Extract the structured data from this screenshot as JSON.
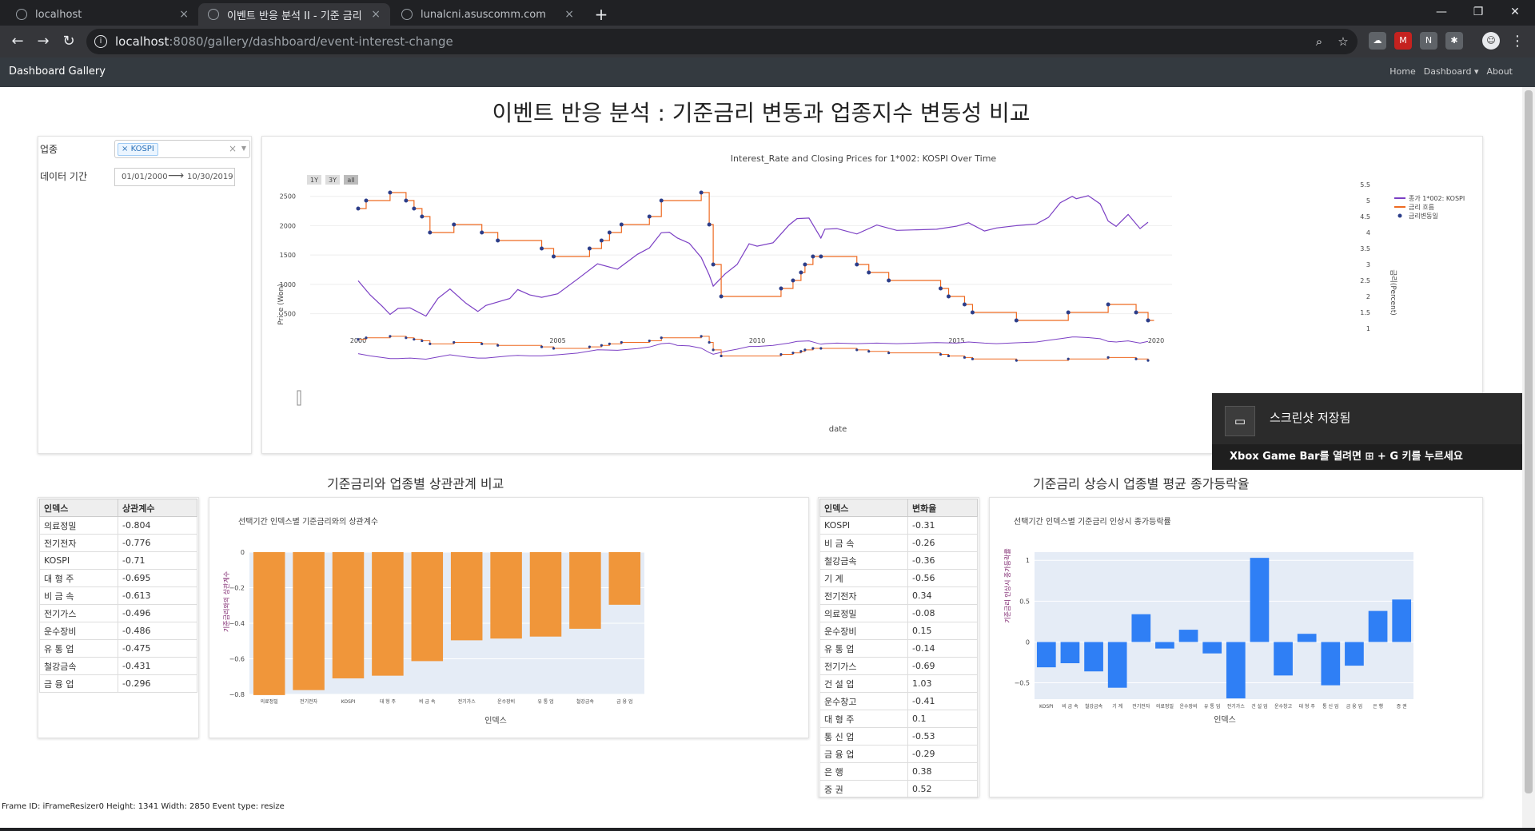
{
  "browser": {
    "tabs": [
      {
        "title": "localhost",
        "active": false
      },
      {
        "title": "이벤트 반응 분석 II - 기준 금리",
        "active": true
      },
      {
        "title": "lunalcni.asuscomm.com",
        "active": false
      }
    ],
    "address": {
      "host": "localhost",
      "path": ":8080/gallery/dashboard/event-interest-change"
    }
  },
  "app": {
    "brand": "Dashboard Gallery",
    "nav": {
      "home": "Home",
      "dashboard": "Dashboard",
      "about": "About"
    }
  },
  "page": {
    "title": "이벤트 반응 분석 : 기준금리 변동과 업종지수 변동성 비교"
  },
  "filters": {
    "industry_label": "업종",
    "industry_selected": "KOSPI",
    "period_label": "데이터 기간",
    "start_date": "01/01/2000",
    "end_date": "10/30/2019"
  },
  "timeseries": {
    "title": "Interest_Rate and Closing Prices for 1*002: KOSPI Over Time",
    "range_buttons": [
      "1Y",
      "3Y",
      "all"
    ],
    "ylabel_left": "Price (Won)",
    "ylabel_right": "금리(Percent)",
    "xlabel": "date",
    "legend": [
      "종가 1*002: KOSPI",
      "금리 흐름",
      "금리변동일"
    ],
    "colors": {
      "price": "#7b3fc4",
      "rate": "#ee6a22",
      "event": "#2c3e8a"
    }
  },
  "correlation": {
    "section_title": "기준금리와 업종별 상관관계 비교",
    "headers": [
      "인덱스",
      "상관계수"
    ],
    "rows": [
      [
        "의료정밀",
        "-0.804"
      ],
      [
        "전기전자",
        "-0.776"
      ],
      [
        "KOSPI",
        "-0.71"
      ],
      [
        "대 형 주",
        "-0.695"
      ],
      [
        "비 금 속",
        "-0.613"
      ],
      [
        "전기가스",
        "-0.496"
      ],
      [
        "운수장비",
        "-0.486"
      ],
      [
        "유 통 업",
        "-0.475"
      ],
      [
        "철강금속",
        "-0.431"
      ],
      [
        "금 융 업",
        "-0.296"
      ]
    ]
  },
  "change": {
    "section_title": "기준금리 상승시 업종별 평균 종가등락율",
    "headers": [
      "인덱스",
      "변화율"
    ],
    "rows": [
      [
        "KOSPI",
        "-0.31"
      ],
      [
        "비 금 속",
        "-0.26"
      ],
      [
        "철강금속",
        "-0.36"
      ],
      [
        "기 계",
        "-0.56"
      ],
      [
        "전기전자",
        "0.34"
      ],
      [
        "의료정밀",
        "-0.08"
      ],
      [
        "운수장비",
        "0.15"
      ],
      [
        "유 통 업",
        "-0.14"
      ],
      [
        "전기가스",
        "-0.69"
      ],
      [
        "건 설 업",
        "1.03"
      ],
      [
        "운수창고",
        "-0.41"
      ],
      [
        "대 형 주",
        "0.1"
      ],
      [
        "통 신 업",
        "-0.53"
      ],
      [
        "금 융 업",
        "-0.29"
      ],
      [
        "은 행",
        "0.38"
      ],
      [
        "증 권",
        "0.52"
      ]
    ]
  },
  "chart_data": [
    {
      "type": "line",
      "title": "Interest_Rate and Closing Prices for 1*002: KOSPI Over Time",
      "xlabel": "date",
      "ylabel": "Price (Won)",
      "ylabel_right": "금리(Percent)",
      "xlim": [
        2000,
        2020
      ],
      "ylim": [
        250,
        2700
      ],
      "ylim_right": [
        1,
        5.5
      ],
      "x_ticks": [
        "2000",
        "2005",
        "2010",
        "2015",
        "2020"
      ],
      "y_ticks": [
        "500",
        "1000",
        "1500",
        "2000",
        "2500"
      ],
      "y_right_ticks": [
        "1",
        "1.5",
        "2",
        "2.5",
        "3",
        "3.5",
        "4",
        "4.5",
        "5",
        "5.5"
      ],
      "series": [
        {
          "name": "종가 1*002: KOSPI",
          "x": [
            2000.0,
            2000.3,
            2000.6,
            2000.8,
            2001.0,
            2001.3,
            2001.7,
            2002.0,
            2002.3,
            2002.7,
            2003.0,
            2003.2,
            2003.5,
            2003.8,
            2004.0,
            2004.3,
            2004.6,
            2005.0,
            2005.5,
            2006.0,
            2006.5,
            2007.0,
            2007.3,
            2007.6,
            2007.8,
            2008.0,
            2008.3,
            2008.6,
            2008.8,
            2008.9,
            2009.2,
            2009.5,
            2009.8,
            2010.0,
            2010.4,
            2010.8,
            2011.0,
            2011.3,
            2011.6,
            2011.7,
            2012.0,
            2012.5,
            2013.0,
            2013.5,
            2014.0,
            2014.5,
            2015.0,
            2015.3,
            2015.7,
            2016.0,
            2016.5,
            2017.0,
            2017.3,
            2017.6,
            2017.9,
            2018.0,
            2018.3,
            2018.6,
            2018.8,
            2019.0,
            2019.3,
            2019.6,
            2019.8
          ],
          "values": [
            1000,
            800,
            650,
            550,
            550,
            600,
            500,
            700,
            900,
            700,
            600,
            600,
            700,
            800,
            850,
            800,
            800,
            900,
            1050,
            1350,
            1300,
            1450,
            1600,
            1900,
            1950,
            1750,
            1700,
            1500,
            1100,
            950,
            1200,
            1400,
            1650,
            1650,
            1750,
            1950,
            2100,
            2150,
            1850,
            1900,
            1950,
            1900,
            1950,
            1900,
            1950,
            2000,
            1950,
            2050,
            1950,
            1900,
            1980,
            2050,
            2200,
            2350,
            2500,
            2500,
            2450,
            2350,
            2100,
            2050,
            2150,
            1950,
            2100
          ]
        },
        {
          "name": "금리 흐름",
          "x": [
            2000.0,
            2000.2,
            2000.8,
            2001.2,
            2001.4,
            2001.6,
            2001.8,
            2002.4,
            2003.1,
            2003.5,
            2004.6,
            2004.9,
            2005.8,
            2006.1,
            2006.3,
            2006.6,
            2007.3,
            2007.6,
            2008.6,
            2008.8,
            2008.9,
            2009.1,
            2010.6,
            2010.9,
            2011.1,
            2011.2,
            2011.4,
            2011.6,
            2012.5,
            2012.8,
            2013.3,
            2014.6,
            2014.8,
            2015.2,
            2015.4,
            2016.5,
            2017.8,
            2018.8,
            2019.5,
            2019.8
          ],
          "values": [
            4.75,
            5.0,
            5.25,
            5.0,
            4.75,
            4.5,
            4.0,
            4.25,
            4.0,
            3.75,
            3.5,
            3.25,
            3.5,
            3.75,
            4.0,
            4.25,
            4.5,
            5.0,
            5.25,
            4.25,
            3.0,
            2.0,
            2.25,
            2.5,
            2.75,
            3.0,
            3.25,
            3.25,
            3.0,
            2.75,
            2.5,
            2.25,
            2.0,
            1.75,
            1.5,
            1.25,
            1.5,
            1.75,
            1.5,
            1.25
          ]
        }
      ]
    },
    {
      "type": "bar",
      "title": "선택기간 인덱스별 기준금리와의 상관계수",
      "xlabel": "인덱스",
      "ylabel": "기준금리와의 상관계수",
      "ylim": [
        -0.8,
        0
      ],
      "y_ticks": [
        "0",
        "−0.2",
        "−0.4",
        "−0.6",
        "−0.8"
      ],
      "categories": [
        "의료정밀",
        "전기전자",
        "KOSPI",
        "대 형 주",
        "비 금 속",
        "전기가스",
        "운수장비",
        "유 통 업",
        "철강금속",
        "금 융 업"
      ],
      "values": [
        -0.804,
        -0.776,
        -0.71,
        -0.695,
        -0.613,
        -0.496,
        -0.486,
        -0.475,
        -0.431,
        -0.296
      ],
      "color": "#f0963a"
    },
    {
      "type": "bar",
      "title": "선택기간 인덱스별 기준금리 인상시 종가등락률",
      "xlabel": "인덱스",
      "ylabel": "기준금리 인상시 종가등락률",
      "ylim": [
        -0.7,
        1.1
      ],
      "y_ticks": [
        "1",
        "0.5",
        "0",
        "−0.5"
      ],
      "categories": [
        "KOSPI",
        "비 금 속",
        "철강금속",
        "기 계",
        "전기전자",
        "의료정밀",
        "운수장비",
        "유 통 업",
        "전기가스",
        "건 설 업",
        "운수창고",
        "대 형 주",
        "통 신 업",
        "금 융 업",
        "은 행",
        "증 권"
      ],
      "values": [
        -0.31,
        -0.26,
        -0.36,
        -0.56,
        0.34,
        -0.08,
        0.15,
        -0.14,
        -0.69,
        1.03,
        -0.41,
        0.1,
        -0.53,
        -0.29,
        0.38,
        0.52
      ],
      "color": "#2f7ff5"
    }
  ],
  "toast": {
    "title": "스크린샷 저장됨",
    "hint": "Xbox Game Bar를 열려면 ⊞ + G 키를 누르세요"
  },
  "status": {
    "text": "Frame ID: iFrameResizer0 Height: 1341 Width: 2850 Event type: resize"
  }
}
